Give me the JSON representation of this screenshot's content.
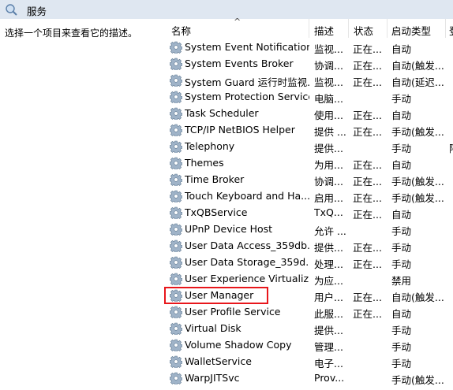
{
  "window": {
    "title": "服务"
  },
  "left_pane": {
    "description": "选择一个项目来查看它的描述。"
  },
  "columns": {
    "name": "名称",
    "sort_arrow": "^",
    "description": "描述",
    "status": "状态",
    "startup_type": "启动类型",
    "more": "登"
  },
  "services": [
    {
      "name": "System Event Notification...",
      "desc": "监视...",
      "status": "正在...",
      "startup": "自动",
      "more": ""
    },
    {
      "name": "System Events Broker",
      "desc": "协调...",
      "status": "正在...",
      "startup": "自动(触发...",
      "more": ""
    },
    {
      "name": "System Guard 运行时监视...",
      "desc": "监视...",
      "status": "正在...",
      "startup": "自动(延迟...",
      "more": ""
    },
    {
      "name": "System Protection Service",
      "desc": "电脑...",
      "status": "",
      "startup": "手动",
      "more": ""
    },
    {
      "name": "Task Scheduler",
      "desc": "使用...",
      "status": "正在...",
      "startup": "自动",
      "more": ""
    },
    {
      "name": "TCP/IP NetBIOS Helper",
      "desc": "提供 ...",
      "status": "正在...",
      "startup": "手动(触发...",
      "more": ""
    },
    {
      "name": "Telephony",
      "desc": "提供...",
      "status": "",
      "startup": "手动",
      "more": "阿"
    },
    {
      "name": "Themes",
      "desc": "为用...",
      "status": "正在...",
      "startup": "自动",
      "more": ""
    },
    {
      "name": "Time Broker",
      "desc": "协调...",
      "status": "正在...",
      "startup": "手动(触发...",
      "more": ""
    },
    {
      "name": "Touch Keyboard and Ha...",
      "desc": "启用...",
      "status": "正在...",
      "startup": "手动(触发...",
      "more": ""
    },
    {
      "name": "TxQBService",
      "desc": "TxQ...",
      "status": "正在...",
      "startup": "自动",
      "more": ""
    },
    {
      "name": "UPnP Device Host",
      "desc": "允许 ...",
      "status": "",
      "startup": "手动",
      "more": ""
    },
    {
      "name": "User Data Access_359db...",
      "desc": "提供...",
      "status": "正在...",
      "startup": "手动",
      "more": ""
    },
    {
      "name": "User Data Storage_359d...",
      "desc": "处理...",
      "status": "正在...",
      "startup": "手动",
      "more": ""
    },
    {
      "name": "User Experience Virtualiz...",
      "desc": "为应...",
      "status": "",
      "startup": "禁用",
      "more": ""
    },
    {
      "name": "User Manager",
      "desc": "用户...",
      "status": "正在...",
      "startup": "自动(触发...",
      "more": ""
    },
    {
      "name": "User Profile Service",
      "desc": "此服...",
      "status": "正在...",
      "startup": "自动",
      "more": ""
    },
    {
      "name": "Virtual Disk",
      "desc": "提供...",
      "status": "",
      "startup": "手动",
      "more": ""
    },
    {
      "name": "Volume Shadow Copy",
      "desc": "管理...",
      "status": "",
      "startup": "手动",
      "more": ""
    },
    {
      "name": "WalletService",
      "desc": "电子...",
      "status": "",
      "startup": "手动",
      "more": ""
    },
    {
      "name": "WarpJITSvc",
      "desc": "Prov...",
      "status": "",
      "startup": "手动(触发...",
      "more": ""
    }
  ],
  "icon": "gear-icon",
  "highlight_color": "#e8161b"
}
